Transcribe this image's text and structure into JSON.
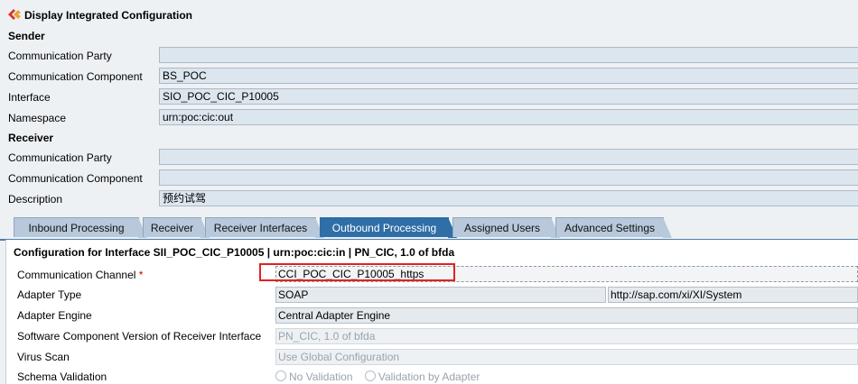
{
  "window": {
    "title": "Display Integrated Configuration"
  },
  "sender": {
    "heading": "Sender",
    "fields": [
      {
        "label": "Communication Party",
        "value": ""
      },
      {
        "label": "Communication Component",
        "value": "BS_POC"
      },
      {
        "label": "Interface",
        "value": "SIO_POC_CIC_P10005"
      },
      {
        "label": "Namespace",
        "value": "urn:poc:cic:out"
      }
    ]
  },
  "receiver": {
    "heading": "Receiver",
    "fields": [
      {
        "label": "Communication Party",
        "value": ""
      },
      {
        "label": "Communication Component",
        "value": ""
      },
      {
        "label": "Description",
        "value": "预约试驾"
      }
    ]
  },
  "tabs": [
    {
      "label": "Inbound Processing",
      "active": false
    },
    {
      "label": "Receiver",
      "active": false
    },
    {
      "label": "Receiver Interfaces",
      "active": false
    },
    {
      "label": "Outbound Processing",
      "active": true
    },
    {
      "label": "Assigned Users",
      "active": false
    },
    {
      "label": "Advanced Settings",
      "active": false
    }
  ],
  "outbound": {
    "config_title": "Configuration for Interface SII_POC_CIC_P10005 | urn:poc:cic:in | PN_CIC, 1.0 of bfda",
    "communication_channel": {
      "label": "Communication Channel",
      "required_mark": "*",
      "value": "CCI_POC_CIC_P10005_https"
    },
    "adapter_type": {
      "label": "Adapter Type",
      "value": "SOAP",
      "namespace": "http://sap.com/xi/XI/System"
    },
    "adapter_engine": {
      "label": "Adapter Engine",
      "value": "Central Adapter Engine"
    },
    "swcv": {
      "label": "Software Component Version of Receiver Interface",
      "value": "PN_CIC, 1.0 of bfda"
    },
    "virus_scan": {
      "label": "Virus Scan",
      "value": "Use Global Configuration"
    },
    "schema_validation": {
      "label": "Schema Validation",
      "options": [
        "No Validation",
        "Validation by Adapter"
      ]
    }
  },
  "colors": {
    "active_tab": "#2f6ea6",
    "inactive_tab": "#b7c9da",
    "highlight": "#e0221e"
  }
}
